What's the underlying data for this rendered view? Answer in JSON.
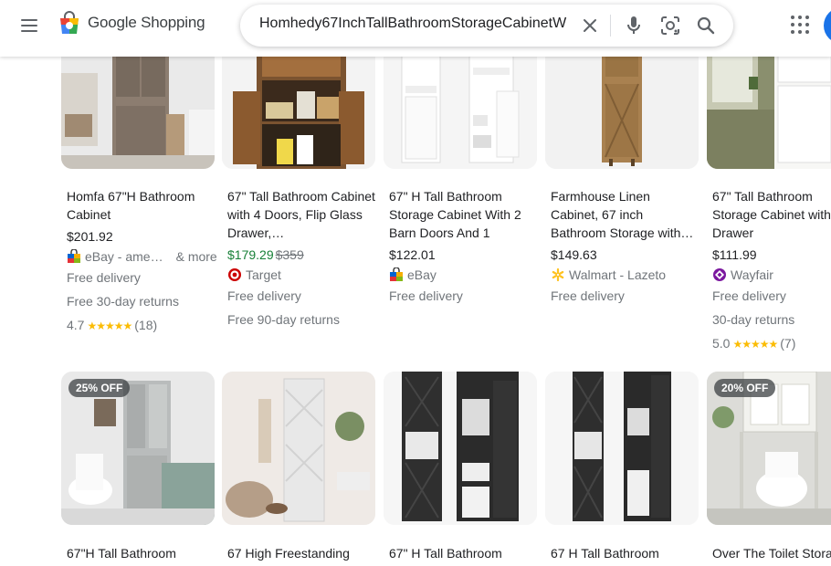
{
  "header": {
    "logo_text": "Google Shopping",
    "search_value": "Homhedy67InchTallBathroomStorageCabinetW"
  },
  "colors": {
    "sale_price": "#188038",
    "star": "#fbbc04",
    "link_blue": "#1a73e8"
  },
  "row1": [
    {
      "title": "Homfa 67\"H Bathroom Cabinet",
      "price": "$201.92",
      "seller": "eBay - ame…",
      "more": "& more",
      "seller_icon": "ebay-bag-icon",
      "delivery": "Free delivery",
      "returns": "Free 30-day returns",
      "rating": "4.7",
      "stars": "★★★★★",
      "reviews": "(18)"
    },
    {
      "title": "67\" Tall Bathroom Cabinet with 4 Doors, Flip Glass Drawer,…",
      "sale_price": "$179.29",
      "was_price": "$359",
      "seller": "Target",
      "seller_icon": "target-icon",
      "delivery": "Free delivery",
      "returns": "Free 90-day returns"
    },
    {
      "title": "67\" H Tall Bathroom Storage Cabinet With 2 Barn Doors And 1",
      "price": "$122.01",
      "seller": "eBay",
      "seller_icon": "ebay-bag-icon",
      "delivery": "Free delivery"
    },
    {
      "title": "Farmhouse Linen Cabinet, 67 inch Bathroom Storage with…",
      "price": "$149.63",
      "seller": "Walmart - Lazeto",
      "seller_icon": "walmart-spark-icon",
      "delivery": "Free delivery"
    },
    {
      "title": "67\" Tall Bathroom Storage Cabinet with Drawer",
      "price": "$111.99",
      "seller": "Wayfair",
      "seller_icon": "wayfair-icon",
      "delivery": "Free delivery",
      "returns": "30-day returns",
      "rating": "5.0",
      "stars": "★★★★★",
      "reviews": "(7)"
    }
  ],
  "row2": [
    {
      "badge": "25% OFF",
      "title": "67\"H Tall Bathroom"
    },
    {
      "title": "67 High Freestanding"
    },
    {
      "title": "67\" H Tall Bathroom"
    },
    {
      "title": "67 H Tall Bathroom"
    },
    {
      "badge": "20% OFF",
      "title": "Over The Toilet Stora"
    }
  ]
}
